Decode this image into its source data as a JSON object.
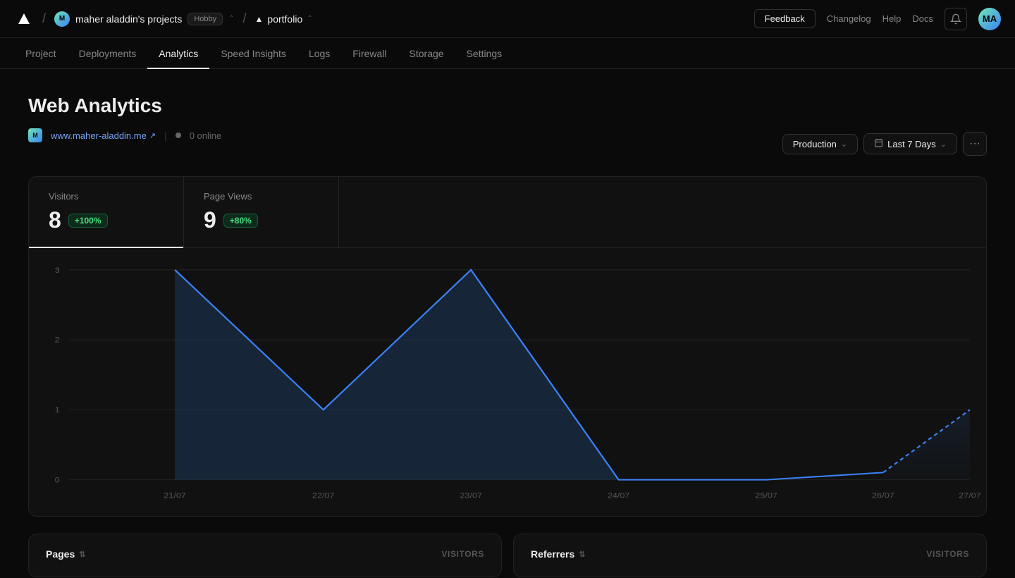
{
  "app": {
    "logo_text": "▲"
  },
  "topnav": {
    "sep1": "/",
    "user_initials": "M",
    "user_name": "maher aladdin's projects",
    "hobby_label": "Hobby",
    "sep2": "/",
    "project_icon": "▲",
    "project_name": "portfolio",
    "feedback_label": "Feedback",
    "changelog_label": "Changelog",
    "help_label": "Help",
    "docs_label": "Docs",
    "bell_icon": "🔔",
    "avatar_initials": "MA"
  },
  "subnav": {
    "items": [
      {
        "label": "Project",
        "active": false
      },
      {
        "label": "Deployments",
        "active": false
      },
      {
        "label": "Analytics",
        "active": true
      },
      {
        "label": "Speed Insights",
        "active": false
      },
      {
        "label": "Logs",
        "active": false
      },
      {
        "label": "Firewall",
        "active": false
      },
      {
        "label": "Storage",
        "active": false
      },
      {
        "label": "Settings",
        "active": false
      }
    ]
  },
  "main": {
    "title": "Web Analytics",
    "site_icon": "M",
    "site_url": "www.maher-aladdin.me",
    "external_icon": "↗",
    "online_count": "0 online",
    "filter_production": "Production",
    "filter_chevron": "⌄",
    "filter_calendar_icon": "📅",
    "filter_days": "Last 7 Days",
    "more_icon": "•••"
  },
  "stats": {
    "visitors_label": "Visitors",
    "visitors_value": "8",
    "visitors_change": "+100%",
    "pageviews_label": "Page Views",
    "pageviews_value": "9",
    "pageviews_change": "+80%"
  },
  "chart": {
    "y_labels": [
      "3",
      "2",
      "1",
      "0"
    ],
    "x_labels": [
      "21/07",
      "22/07",
      "23/07",
      "24/07",
      "25/07",
      "26/07",
      "27/07"
    ],
    "data_points": [
      {
        "date": "21/07",
        "value": 3
      },
      {
        "date": "22/07",
        "value": 1
      },
      {
        "date": "23/07",
        "value": 3
      },
      {
        "date": "24/07",
        "value": 0
      },
      {
        "date": "25/07",
        "value": 0
      },
      {
        "date": "26/07",
        "value": 0.1
      },
      {
        "date": "27/07",
        "value": 1
      }
    ]
  },
  "bottom": {
    "pages_label": "Pages",
    "pages_visitors_label": "VISITORS",
    "referrers_label": "Referrers",
    "referrers_visitors_label": "VISITORS"
  }
}
